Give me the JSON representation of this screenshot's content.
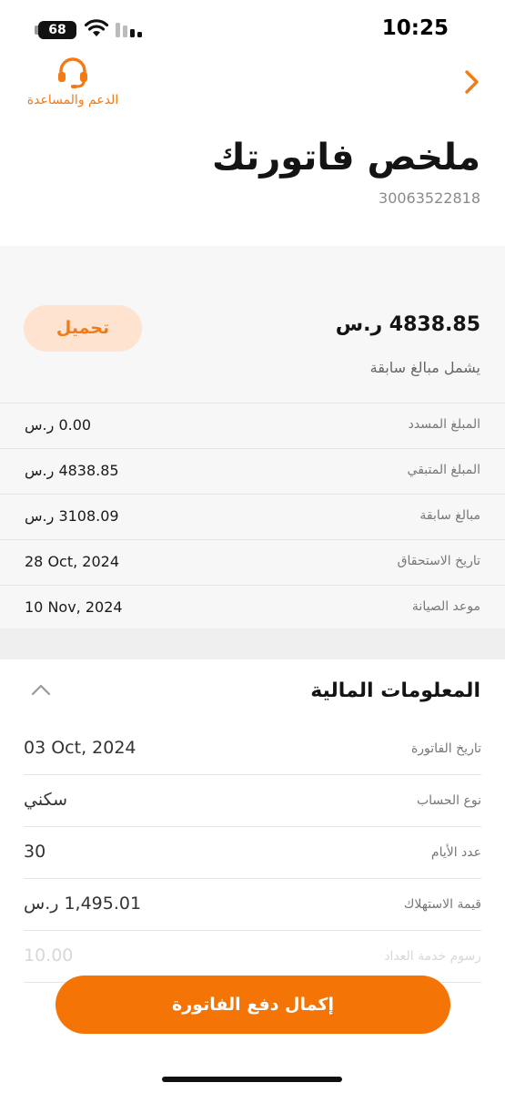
{
  "status_bar": {
    "time": "10:25",
    "battery": "68"
  },
  "header": {
    "support_label": "الدعم والمساعدة"
  },
  "page": {
    "title": "ملخص فاتورتك",
    "invoice_number": "30063522818"
  },
  "summary": {
    "download_label": "تحميل",
    "total_amount": "4838.85 ر.س",
    "total_note": "يشمل مبالغ سابقة",
    "rows": [
      {
        "label": "المبلغ المسدد",
        "value": "0.00 ر.س"
      },
      {
        "label": "المبلغ المتبقي",
        "value": "4838.85 ر.س"
      },
      {
        "label": "مبالغ سابقة",
        "value": "3108.09 ر.س"
      },
      {
        "label": "تاريخ الاستحقاق",
        "value": "28 Oct, 2024"
      },
      {
        "label": "موعد الصيانة",
        "value": "10 Nov, 2024"
      }
    ]
  },
  "financial": {
    "title": "المعلومات المالية",
    "rows": [
      {
        "label": "تاريخ الفاتورة",
        "value": "03 Oct, 2024"
      },
      {
        "label": "نوع الحساب",
        "value": "سكني"
      },
      {
        "label": "عدد الأيام",
        "value": "30"
      },
      {
        "label": "قيمة الاستهلاك",
        "value": "1,495.01 ر.س"
      },
      {
        "label": "رسوم خدمة العداد",
        "value": "10.00"
      }
    ]
  },
  "footer": {
    "pay_label": "إكمال دفع الفاتورة"
  },
  "colors": {
    "accent": "#f47406",
    "accent_soft": "#fde3d0"
  }
}
